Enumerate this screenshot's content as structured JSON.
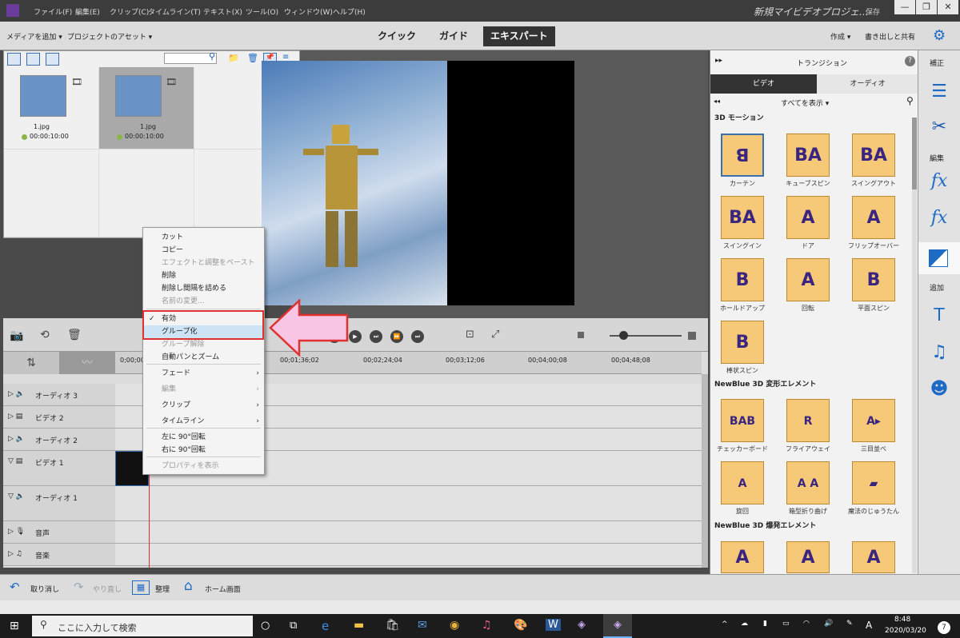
{
  "titlebar": {
    "menus": [
      "ファイル(F)",
      "編集(E)",
      "クリップ(C)",
      "タイムライン(T)",
      "テキスト(X)",
      "ツール(O)",
      "ウィンドウ(W)",
      "ヘルプ(H)"
    ],
    "title": "新規マイビデオプロジェ...",
    "save": "保存"
  },
  "modebar": {
    "add_media": "メディアを追加 ▾",
    "project_assets": "プロジェクトのアセット ▾",
    "modes": [
      "クイック",
      "ガイド",
      "エキスパート"
    ],
    "create": "作成 ▾",
    "export_share": "書き出しと共有"
  },
  "media": {
    "items": [
      {
        "name": "1.jpg",
        "duration": "00:00:10:00"
      },
      {
        "name": "1.jpg",
        "duration": "00:00:10:00"
      }
    ]
  },
  "timeline": {
    "timecodes": [
      "0;00;00",
      "00;01;36;02",
      "00;02;24;04",
      "00;03;12;06",
      "00;04;00;08",
      "00;04;48;08"
    ],
    "tracks": [
      "オーディオ 3",
      "ビデオ 2",
      "オーディオ 2",
      "ビデオ 1",
      "オーディオ 1",
      "音声",
      "音楽"
    ]
  },
  "context_menu": {
    "items": [
      {
        "label": "カット",
        "disabled": false
      },
      {
        "label": "コピー",
        "disabled": false
      },
      {
        "label": "エフェクトと調整をペースト",
        "disabled": true
      },
      {
        "label": "削除",
        "disabled": false
      },
      {
        "label": "削除し間隔を詰める",
        "disabled": false
      },
      {
        "label": "名前の変更...",
        "disabled": true
      },
      {
        "label": "有効",
        "disabled": false,
        "checked": true
      },
      {
        "label": "グループ化",
        "disabled": false,
        "selected": true
      },
      {
        "label": "グループ解除",
        "disabled": true
      },
      {
        "label": "自動パンとズーム",
        "disabled": false
      },
      {
        "label": "フェード",
        "disabled": false,
        "submenu": true
      },
      {
        "label": "編集",
        "disabled": true,
        "submenu": true
      },
      {
        "label": "クリップ",
        "disabled": false,
        "submenu": true
      },
      {
        "label": "タイムライン",
        "disabled": false,
        "submenu": true
      },
      {
        "label": "左に 90°回転",
        "disabled": false
      },
      {
        "label": "右に 90°回転",
        "disabled": false
      },
      {
        "label": "プロパティを表示",
        "disabled": true
      }
    ]
  },
  "transitions": {
    "title": "トランジション",
    "tabs": [
      "ビデオ",
      "オーディオ"
    ],
    "filter": "すべてを表示 ▾",
    "sections": [
      {
        "name": "3D モーション",
        "items": [
          "カーテン",
          "キューブスピン",
          "スイングアウト",
          "スイングイン",
          "ドア",
          "フリップオーバー",
          "ホールドアップ",
          "回転",
          "平面スピン",
          "棒状スピン"
        ]
      },
      {
        "name": "NewBlue 3D 変形エレメント",
        "items": [
          "チェッカーボード",
          "フライアウェイ",
          "三目並べ",
          "旋回",
          "箱型折り曲げ",
          "魔法のじゅうたん"
        ]
      },
      {
        "name": "NewBlue 3D 爆発エレメント",
        "items": []
      }
    ]
  },
  "right_toolbar": {
    "labels": [
      "補正",
      "編集",
      "追加"
    ]
  },
  "bottombar": {
    "undo": "取り消し",
    "redo": "やり直し",
    "organize": "整理",
    "home": "ホーム画面"
  },
  "taskbar": {
    "search_placeholder": "ここに入力して検索",
    "time": "8:48",
    "date": "2020/03/20",
    "ime": "A",
    "badge": "7"
  }
}
